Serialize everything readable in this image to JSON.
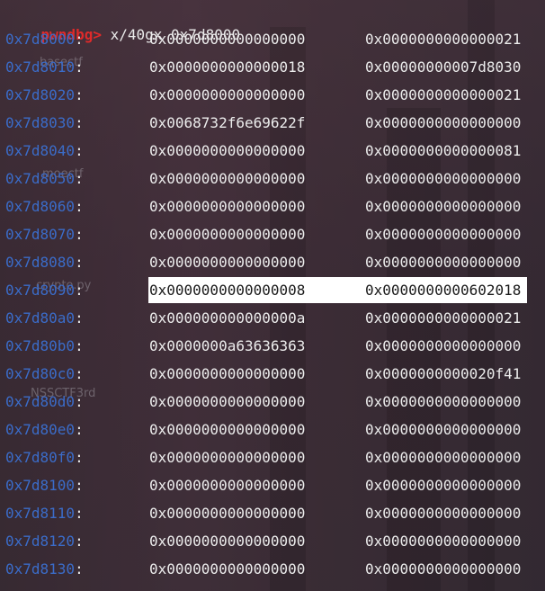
{
  "terminal": {
    "prompt": "pwndbg>",
    "command": "x/40gx 0x7d8000"
  },
  "desktop_icons": [
    "basectf",
    "moectf",
    "crypto.py",
    "NSSCTF3rd"
  ],
  "colors": {
    "prompt": "#e02a2a",
    "address": "#3b6cc9",
    "value": "#ececec",
    "highlight_bg": "#ffffff",
    "highlight_text": "#1a1a1a"
  },
  "memory_dump": [
    {
      "address": "0x7d8000",
      "values": [
        "0x0000000000000000",
        "0x0000000000000021"
      ]
    },
    {
      "address": "0x7d8010",
      "values": [
        "0x0000000000000018",
        "0x00000000007d8030"
      ]
    },
    {
      "address": "0x7d8020",
      "values": [
        "0x0000000000000000",
        "0x0000000000000021"
      ]
    },
    {
      "address": "0x7d8030",
      "values": [
        "0x0068732f6e69622f",
        "0x0000000000000000"
      ]
    },
    {
      "address": "0x7d8040",
      "values": [
        "0x0000000000000000",
        "0x0000000000000081"
      ]
    },
    {
      "address": "0x7d8050",
      "values": [
        "0x0000000000000000",
        "0x0000000000000000"
      ]
    },
    {
      "address": "0x7d8060",
      "values": [
        "0x0000000000000000",
        "0x0000000000000000"
      ]
    },
    {
      "address": "0x7d8070",
      "values": [
        "0x0000000000000000",
        "0x0000000000000000"
      ]
    },
    {
      "address": "0x7d8080",
      "values": [
        "0x0000000000000000",
        "0x0000000000000000"
      ]
    },
    {
      "address": "0x7d8090",
      "values": [
        "0x0000000000000008",
        "0x0000000000602018"
      ],
      "highlighted": true
    },
    {
      "address": "0x7d80a0",
      "values": [
        "0x000000000000000a",
        "0x0000000000000021"
      ]
    },
    {
      "address": "0x7d80b0",
      "values": [
        "0x0000000a63636363",
        "0x0000000000000000"
      ]
    },
    {
      "address": "0x7d80c0",
      "values": [
        "0x0000000000000000",
        "0x0000000000020f41"
      ]
    },
    {
      "address": "0x7d80d0",
      "values": [
        "0x0000000000000000",
        "0x0000000000000000"
      ]
    },
    {
      "address": "0x7d80e0",
      "values": [
        "0x0000000000000000",
        "0x0000000000000000"
      ]
    },
    {
      "address": "0x7d80f0",
      "values": [
        "0x0000000000000000",
        "0x0000000000000000"
      ]
    },
    {
      "address": "0x7d8100",
      "values": [
        "0x0000000000000000",
        "0x0000000000000000"
      ]
    },
    {
      "address": "0x7d8110",
      "values": [
        "0x0000000000000000",
        "0x0000000000000000"
      ]
    },
    {
      "address": "0x7d8120",
      "values": [
        "0x0000000000000000",
        "0x0000000000000000"
      ]
    },
    {
      "address": "0x7d8130",
      "values": [
        "0x0000000000000000",
        "0x0000000000000000"
      ]
    }
  ]
}
